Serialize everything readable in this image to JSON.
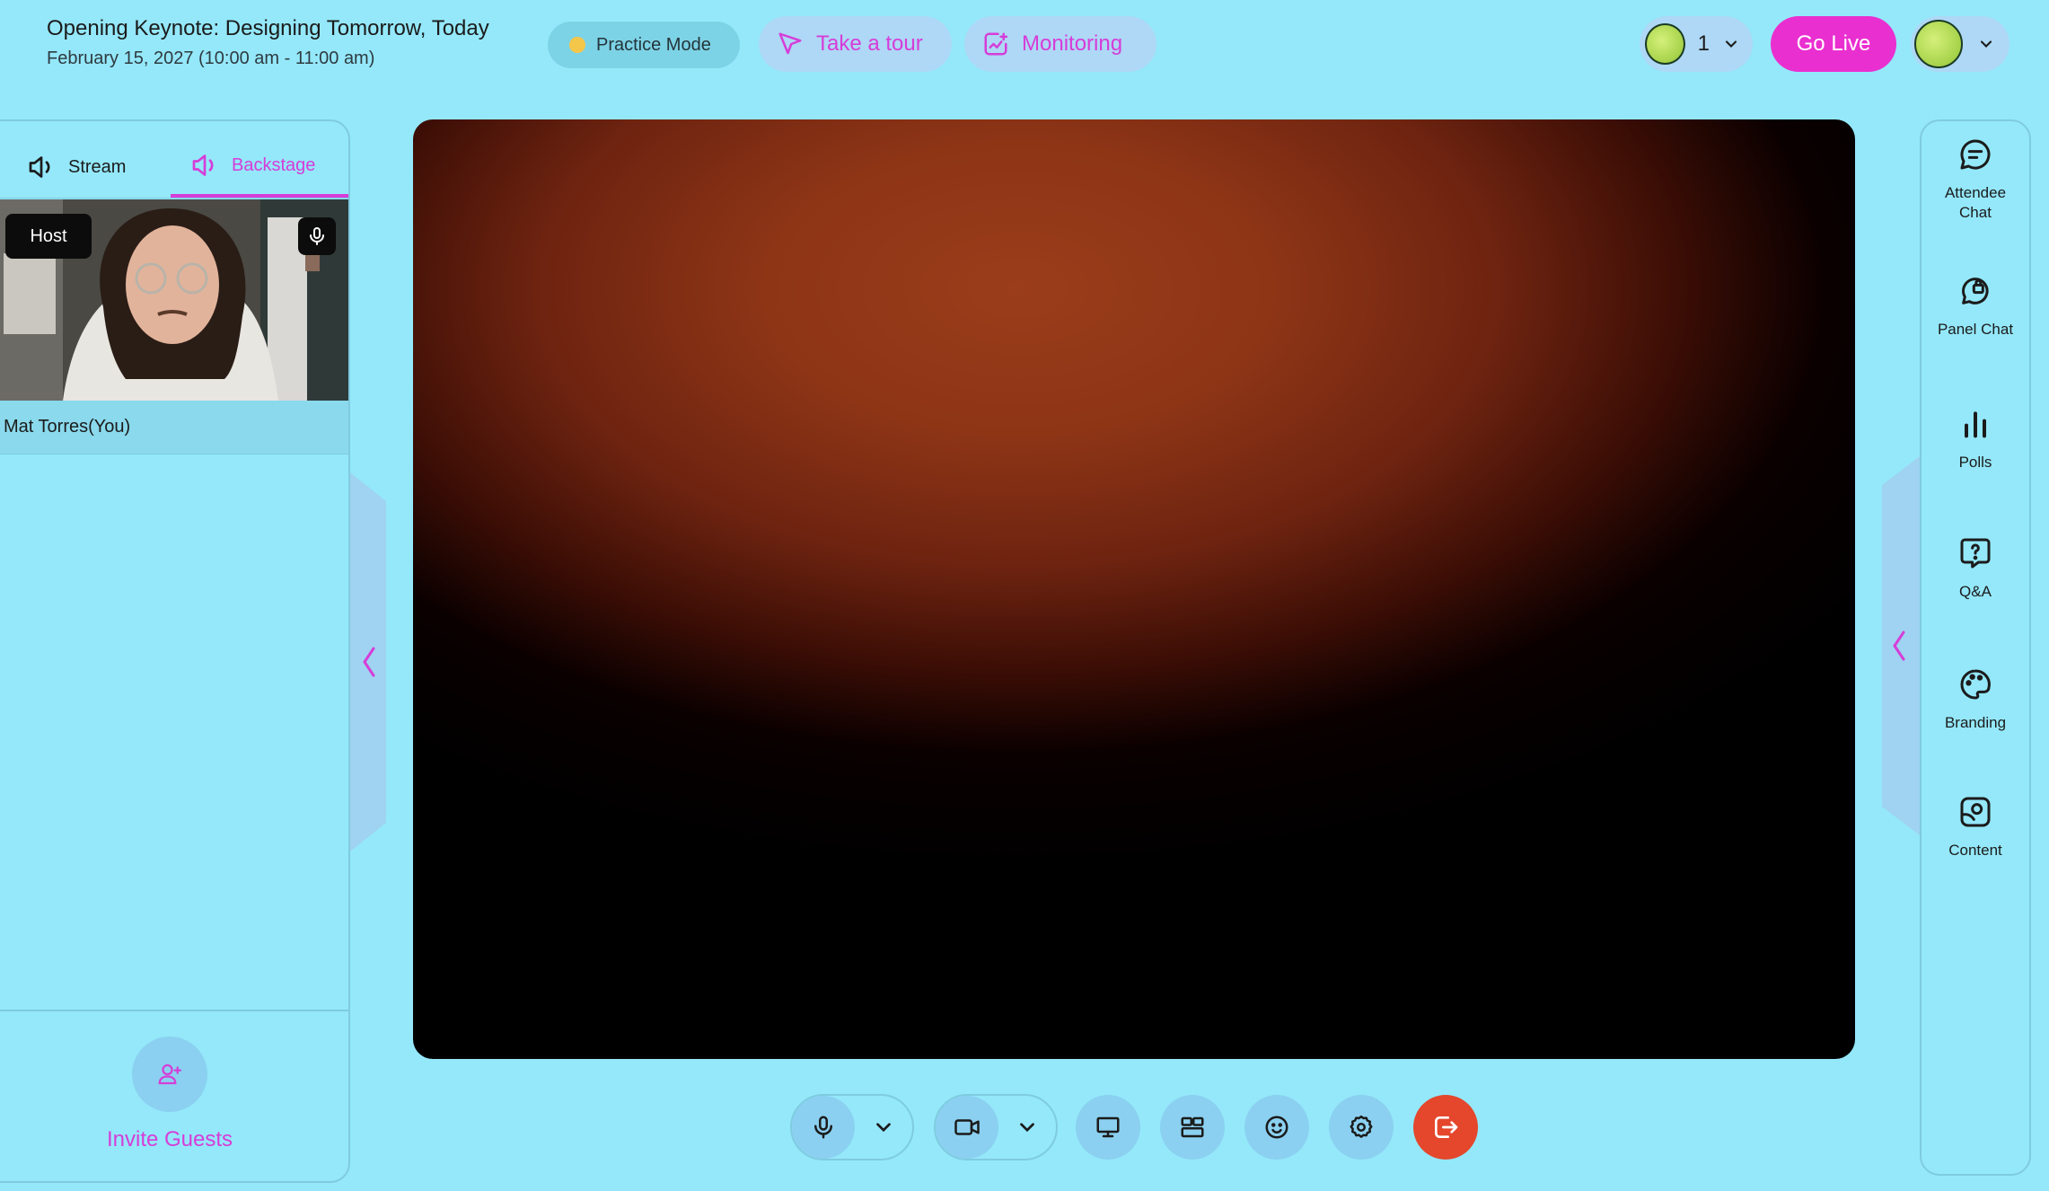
{
  "header": {
    "event_title": "Opening Keynote: Designing Tomorrow, Today",
    "event_date": "February 15, 2027 (10:00 am - 11:00 am)",
    "practice_mode": "Practice Mode",
    "take_tour": "Take a tour",
    "monitoring": "Monitoring",
    "participant_count": "1",
    "go_live": "Go Live"
  },
  "left_panel": {
    "tabs": [
      {
        "label": "Stream",
        "icon": "speaker-icon"
      },
      {
        "label": "Backstage",
        "icon": "speaker-icon"
      }
    ],
    "participant": {
      "role_badge": "Host",
      "name": "Mat Torres(You)"
    },
    "invite_label": "Invite Guests"
  },
  "right_panel": {
    "items": [
      {
        "label_line1": "Attendee",
        "label_line2": "Chat",
        "icon": "chat-icon"
      },
      {
        "label_line1": "Panel Chat",
        "label_line2": "",
        "icon": "lock-chat-icon"
      },
      {
        "label_line1": "Polls",
        "label_line2": "",
        "icon": "bar-chart-icon"
      },
      {
        "label_line1": "Q&A",
        "label_line2": "",
        "icon": "question-icon"
      },
      {
        "label_line1": "Branding",
        "label_line2": "",
        "icon": "palette-icon"
      },
      {
        "label_line1": "Content",
        "label_line2": "",
        "icon": "content-icon"
      }
    ]
  },
  "colors": {
    "background": "#94e8fa",
    "accent": "#d63dd8",
    "go_live": "#ea2fd0",
    "leave": "#e4472c"
  }
}
